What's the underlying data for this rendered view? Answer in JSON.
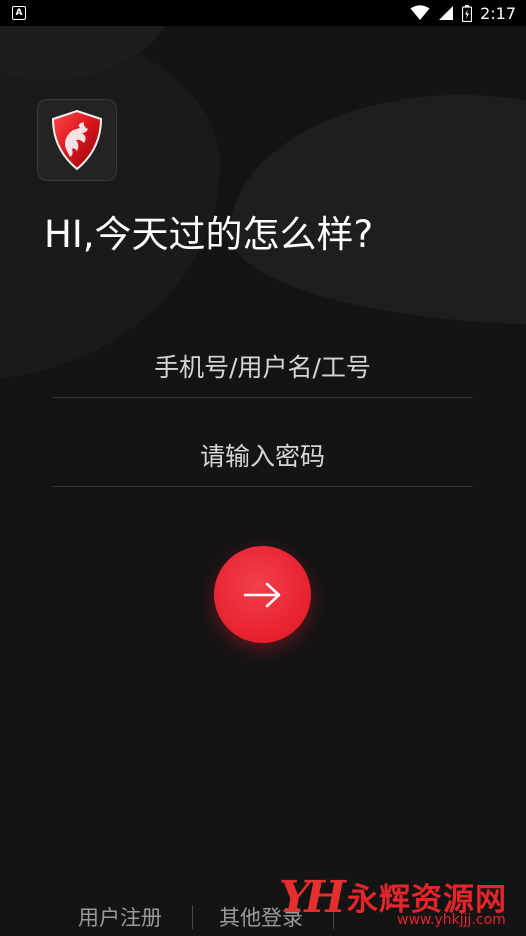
{
  "status_bar": {
    "time": "2:17",
    "left_icon": "a-notification-icon",
    "icons": [
      "wifi-icon",
      "signal-icon",
      "battery-icon"
    ]
  },
  "app": {
    "logo_icon": "dragon-shield-logo-icon",
    "greeting": "HI,今天过的怎么样?"
  },
  "form": {
    "username_placeholder": "手机号/用户名/工号",
    "password_placeholder": "请输入密码",
    "submit_icon": "arrow-right-icon"
  },
  "footer": {
    "register_label": "用户注册",
    "other_login_label": "其他登录"
  },
  "watermark": {
    "logo_text": "YH",
    "name": "永辉资源网",
    "url": "www.yhkjjj.com"
  },
  "colors": {
    "background": "#141414",
    "accent": "#e7202d",
    "text": "#ffffff"
  }
}
